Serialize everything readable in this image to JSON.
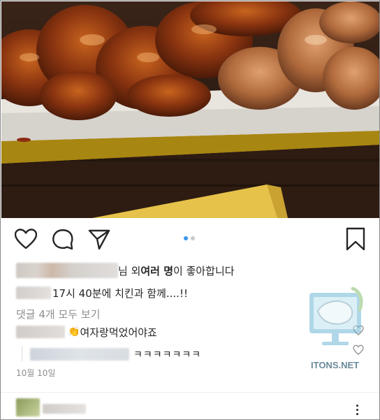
{
  "post": {
    "likes_suffix_a": "님 외 ",
    "likes_bold": "여러 명",
    "likes_suffix_b": "이 좋아합니다",
    "caption": "17시 40분에 치킨과 함께....!!",
    "view_all_comments": "댓글 4개 모두 보기",
    "comment_emoji": "👏",
    "comment_text": "여자랑먹었어야죠",
    "reply_text": "ㅋㅋㅋㅋㅋㅋㅋ",
    "date": "10월 10일",
    "carousel": {
      "count": 2,
      "active_index": 0
    }
  },
  "watermark": {
    "text": "ITONS.NET"
  },
  "icons": {
    "like": "heart-icon",
    "comment": "comment-bubble-icon",
    "share": "paper-plane-icon",
    "save": "bookmark-icon",
    "comment_like": "small-heart-icon",
    "more": "more-vertical-icon"
  },
  "colors": {
    "accent_dot": "#3897f0",
    "inactive_dot": "#c9c9c9",
    "muted_text": "#8e8e8e",
    "text": "#262626"
  }
}
